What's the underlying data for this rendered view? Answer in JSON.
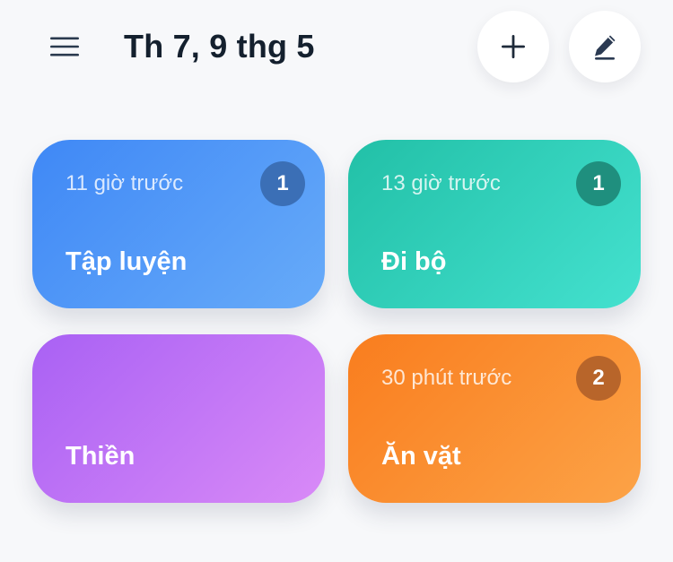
{
  "header": {
    "title": "Th 7, 9 thg 5",
    "menu_icon": "hamburger-menu-icon",
    "add_icon": "plus-icon",
    "edit_icon": "pencil-icon"
  },
  "cards": [
    {
      "name": "Tập luyện",
      "time": "11 giờ trước",
      "count": "1",
      "color": "#4a90f7"
    },
    {
      "name": "Đi bộ",
      "time": "13 giờ trước",
      "count": "1",
      "color": "#2ccfb7"
    },
    {
      "name": "Thiền",
      "time": "",
      "count": "",
      "color": "#bb72f5"
    },
    {
      "name": "Ăn vặt",
      "time": "30 phút trước",
      "count": "2",
      "color": "#fa8c2e"
    }
  ]
}
